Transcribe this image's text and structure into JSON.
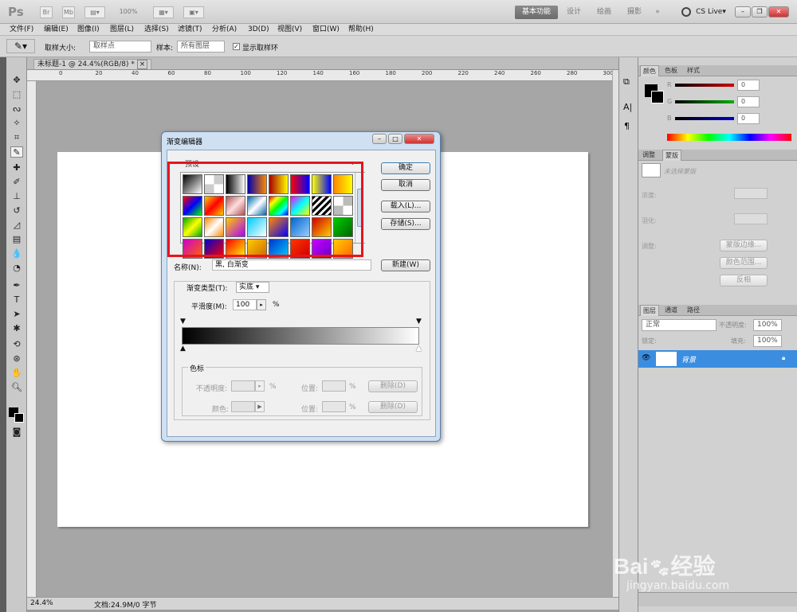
{
  "app": {
    "logo": "Ps",
    "zoom": "100%",
    "workspaces": [
      "基本功能",
      "设计",
      "绘画",
      "摄影"
    ],
    "active_workspace": "基本功能",
    "more": "»",
    "cs_live": "CS Live▾"
  },
  "menu": [
    "文件(F)",
    "编辑(E)",
    "图像(I)",
    "图层(L)",
    "选择(S)",
    "滤镜(T)",
    "分析(A)",
    "3D(D)",
    "视图(V)",
    "窗口(W)",
    "帮助(H)"
  ],
  "options": {
    "sample_size_label": "取样大小:",
    "sample_size_value": "取样点",
    "sample_label": "样本:",
    "sample_value": "所有图层",
    "show_ring_label": "显示取样环"
  },
  "document": {
    "tab_title": "未标题-1 @ 24.4%(RGB/8) *",
    "close": "×",
    "zoom": "24.4%",
    "status": "文档:24.9M/0 字节"
  },
  "ruler": {
    "top_ticks": [
      "0",
      "20",
      "40",
      "60",
      "80",
      "100",
      "120",
      "140",
      "160",
      "180",
      "200",
      "220",
      "240",
      "260",
      "280",
      "300"
    ]
  },
  "dialog": {
    "title": "渐变编辑器",
    "presets_label": "预设",
    "ok": "确定",
    "cancel": "取消",
    "load": "载入(L)...",
    "save": "存储(S)...",
    "name_label": "名称(N):",
    "name_value": "黑, 白渐变",
    "new": "新建(W)",
    "gradient_type_label": "渐变类型(T):",
    "gradient_type_value": "实底",
    "smoothness_label": "平滑度(M):",
    "smoothness_value": "100",
    "percent": "%",
    "stops_label": "色标",
    "opacity_label": "不透明度:",
    "location_label": "位置:",
    "delete": "删除(D)",
    "color_label": "颜色:",
    "highlight_color": "#e8141b"
  },
  "panels": {
    "color_tabs": [
      "颜色",
      "色板",
      "样式"
    ],
    "channels": [
      {
        "label": "R",
        "value": "0",
        "color": "#d00000"
      },
      {
        "label": "G",
        "value": "0",
        "color": "#00b000"
      },
      {
        "label": "B",
        "value": "0",
        "color": "#0000d0"
      }
    ],
    "adjust_tabs": [
      "调整",
      "蒙版"
    ],
    "mask_hint": "未选择蒙版",
    "density_label": "浓度:",
    "feather_label": "羽化:",
    "refine_label": "调整:",
    "mask_edge": "蒙版边缘...",
    "color_range": "颜色范围...",
    "invert": "反相",
    "layer_tabs": [
      "图层",
      "通道",
      "路径"
    ],
    "blend_mode": "正常",
    "opacity_label": "不透明度:",
    "opacity_value": "100%",
    "lock_label": "锁定:",
    "fill_label": "填充:",
    "fill_value": "100%",
    "layer_name": "背景"
  },
  "watermark": {
    "brand": "Bai",
    "brand2": "经验",
    "url": "jingyan.baidu.com"
  }
}
